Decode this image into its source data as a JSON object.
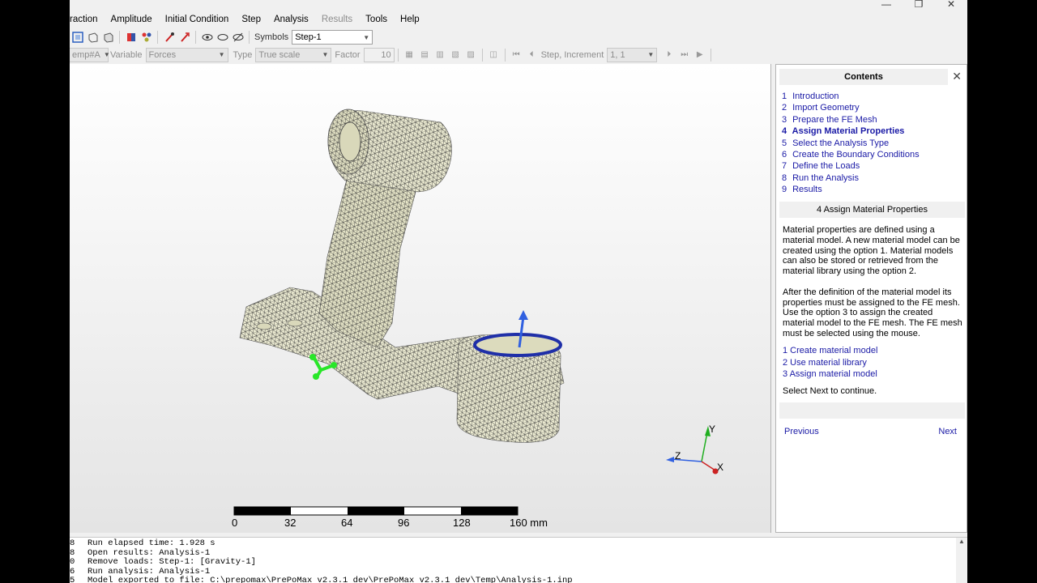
{
  "window": {
    "controls": [
      "—",
      "❐",
      "✕"
    ]
  },
  "menu": {
    "items": [
      {
        "label": "raction",
        "enabled": true
      },
      {
        "label": "Amplitude",
        "enabled": true
      },
      {
        "label": "Initial Condition",
        "enabled": true
      },
      {
        "label": "Step",
        "enabled": true
      },
      {
        "label": "Analysis",
        "enabled": true
      },
      {
        "label": "Results",
        "enabled": false
      },
      {
        "label": "Tools",
        "enabled": true
      },
      {
        "label": "Help",
        "enabled": true
      }
    ]
  },
  "toolbar1": {
    "symbols_label": "Symbols",
    "step_value": "Step-1"
  },
  "toolbar2": {
    "field_value": "emp#A",
    "variable_label": "Variable",
    "variable_value": "Forces",
    "type_label": "Type",
    "type_value": "True scale",
    "factor_label": "Factor",
    "factor_value": "10",
    "step_increment_label": "Step, Increment",
    "step_increment_value": "1, 1"
  },
  "viewport": {
    "scale_bar": {
      "ticks": [
        "0",
        "32",
        "64",
        "96",
        "128",
        "160 mm"
      ]
    },
    "triad": {
      "y": "Y",
      "z": "Z",
      "x": "X"
    },
    "colors": {
      "mesh_fill": "#ecebd2",
      "mesh_line": "#3a3a3a",
      "constraint": "#29e629",
      "load_arrow": "#3060e0",
      "surface_edge": "#1f2fa8"
    }
  },
  "panel": {
    "title": "Contents",
    "toc": [
      {
        "num": "1",
        "label": "Introduction"
      },
      {
        "num": "2",
        "label": "Import Geometry"
      },
      {
        "num": "3",
        "label": "Prepare the FE Mesh"
      },
      {
        "num": "4",
        "label": "Assign Material Properties",
        "current": true
      },
      {
        "num": "5",
        "label": "Select the Analysis Type"
      },
      {
        "num": "6",
        "label": "Create the Boundary Conditions"
      },
      {
        "num": "7",
        "label": "Define the Loads"
      },
      {
        "num": "8",
        "label": "Run the Analysis"
      },
      {
        "num": "9",
        "label": "Results"
      }
    ],
    "section_title": "4  Assign Material Properties",
    "para1": "Material properties are defined using a material model. A new material model can be created using the option 1. Material models can also be stored or retrieved from the material library using the option 2.",
    "para2": "After the definition of the material model its properties must be assigned to the FE mesh. Use the option 3 to assign the created material model to the FE mesh. The FE mesh must be selected using the mouse.",
    "links": [
      "1 Create material model",
      "2 Use material library",
      "3 Assign material model"
    ],
    "note": "Select Next to continue.",
    "previous": "Previous",
    "next": "Next"
  },
  "log": {
    "lines": [
      {
        "num": "8",
        "text": "Run elapsed time: 1.928 s"
      },
      {
        "num": "8",
        "text": "Open results: Analysis-1"
      },
      {
        "num": "0",
        "text": "Remove loads: Step-1: [Gravity-1]"
      },
      {
        "num": "6",
        "text": "Run analysis: Analysis-1"
      },
      {
        "num": "5",
        "text": "Model exported to file: C:\\prepomax\\PrePoMax v2.3.1 dev\\PrePoMax v2.3.1 dev\\Temp\\Analysis-1.inp"
      }
    ]
  }
}
